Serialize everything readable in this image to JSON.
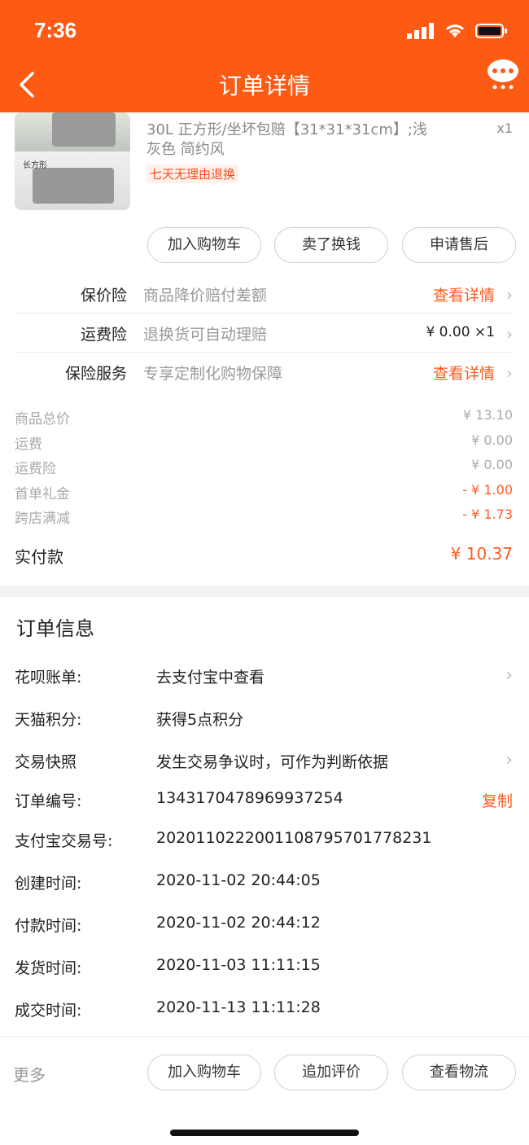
{
  "status_bar": {
    "time": "7:36"
  },
  "header": {
    "title": "订单详情"
  },
  "product": {
    "thumb_label": "长方形",
    "spec": "30L 正方形/坐坏包赔【31*31*31cm】;浅灰色 简约风",
    "qty": "x1",
    "tag": "七天无理由退换"
  },
  "item_actions": [
    "加入购物车",
    "卖了换钱",
    "申请售后"
  ],
  "insurance": [
    {
      "name": "保价险",
      "desc": "商品降价赔付差额",
      "action": "查看详情"
    },
    {
      "name": "运费险",
      "desc": "退换货可自动理赔",
      "action": "¥ 0.00 ×1"
    },
    {
      "name": "保险服务",
      "desc": "专享定制化购物保障",
      "action": "查看详情"
    }
  ],
  "summary": [
    {
      "label": "商品总价",
      "value": "¥ 13.10"
    },
    {
      "label": "运费",
      "value": "¥ 0.00"
    },
    {
      "label": "运费险",
      "value": "¥ 0.00"
    },
    {
      "label": "首单礼金",
      "value": "- ¥ 1.00"
    },
    {
      "label": "跨店满减",
      "value": "- ¥ 1.73"
    }
  ],
  "paid": {
    "label": "实付款",
    "value": "¥ 10.37"
  },
  "order_info": {
    "title": "订单信息",
    "rows": [
      {
        "label": "花呗账单:",
        "value": "去支付宝中查看"
      },
      {
        "label": "天猫积分:",
        "value": "获得5点积分"
      },
      {
        "label": "交易快照",
        "value": "发生交易争议时，可作为判断依据"
      },
      {
        "label": "订单编号:",
        "value": "1343170478969937254",
        "action": "复制"
      },
      {
        "label": "支付宝交易号:",
        "value": "2020110222001108795701778231"
      },
      {
        "label": "创建时间:",
        "value": "2020-11-02 20:44:05"
      },
      {
        "label": "付款时间:",
        "value": "2020-11-02 20:44:12"
      },
      {
        "label": "发货时间:",
        "value": "2020-11-03 11:11:15"
      },
      {
        "label": "成交时间:",
        "value": "2020-11-13 11:11:28"
      }
    ]
  },
  "footer": {
    "more": "更多",
    "buttons": [
      "加入购物车",
      "追加评价",
      "查看物流"
    ]
  },
  "icons": [
    "signal-icon",
    "wifi-icon",
    "battery-icon",
    "back-arrow-icon",
    "chat-bubble-icon",
    "chevron-right-icon"
  ],
  "colors": {
    "brand": "#fd5a13",
    "accent": "#ff5a1f"
  }
}
